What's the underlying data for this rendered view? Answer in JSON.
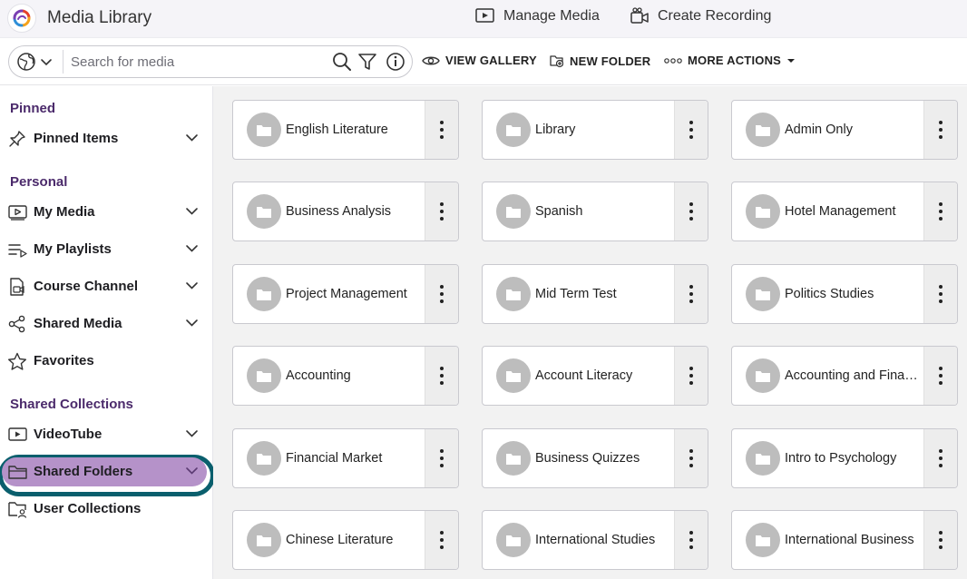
{
  "app": {
    "title": "Media Library"
  },
  "header": {
    "manage_media": "Manage Media",
    "create_recording": "Create Recording"
  },
  "search": {
    "placeholder": "Search for media",
    "value": ""
  },
  "toolbar": {
    "view_gallery": "VIEW GALLERY",
    "new_folder": "NEW FOLDER",
    "more_actions": "MORE ACTIONS"
  },
  "sidebar": {
    "sections": {
      "pinned": "Pinned",
      "personal": "Personal",
      "shared": "Shared Collections"
    },
    "items": [
      {
        "label": "Pinned Items",
        "icon": "pin-icon"
      },
      {
        "label": "My Media",
        "icon": "video-icon"
      },
      {
        "label": "My Playlists",
        "icon": "playlist-icon"
      },
      {
        "label": "Course Channel",
        "icon": "course-icon"
      },
      {
        "label": "Shared Media",
        "icon": "share-icon"
      },
      {
        "label": "Favorites",
        "icon": "star-icon"
      },
      {
        "label": "VideoTube",
        "icon": "video-icon"
      },
      {
        "label": "Shared Folders",
        "icon": "folder-icon",
        "active": true
      },
      {
        "label": "User Collections",
        "icon": "user-folder-icon"
      }
    ]
  },
  "folders": [
    "English Literature",
    "Library",
    "Admin Only",
    "Business Analysis",
    "Spanish",
    "Hotel Management",
    "Project Management",
    "Mid Term Test",
    "Politics Studies",
    "Accounting",
    "Account Literacy",
    "Accounting and Finance",
    "Financial Market",
    "Business Quizzes",
    "Intro to Psychology",
    "Chinese Literature",
    "International Studies",
    "International Business"
  ],
  "colors": {
    "section_heading": "#4b2a6b",
    "active_pill": "#b592c9",
    "active_ring": "#0a5f6d",
    "folder_avatar": "#bdbdbd"
  }
}
